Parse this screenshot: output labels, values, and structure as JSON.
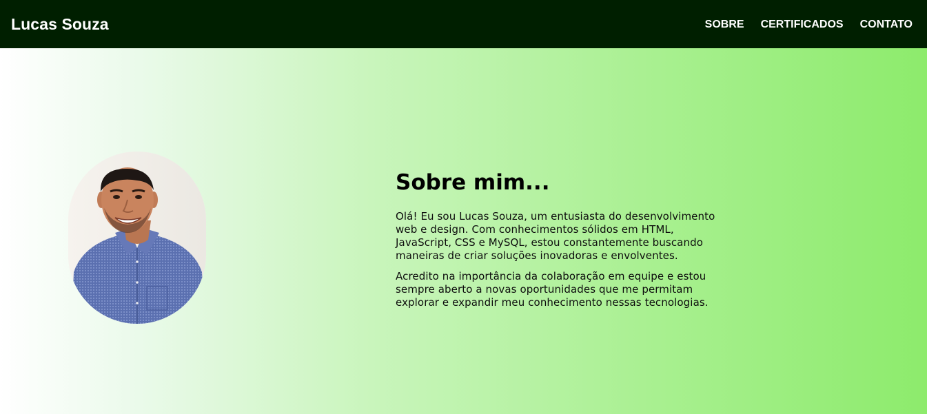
{
  "header": {
    "brand": "Lucas Souza",
    "nav": [
      {
        "label": "SOBRE"
      },
      {
        "label": "CERTIFICADOS"
      },
      {
        "label": "CONTATO"
      }
    ]
  },
  "about": {
    "title": "Sobre mim...",
    "paragraphs": [
      "Olá! Eu sou Lucas Souza, um entusiasta do desenvolvimento web e design. Com conhecimentos sólidos em HTML, JavaScript, CSS e MySQL, estou constantemente buscando maneiras de criar soluções inovadoras e envolventes.",
      "Acredito na importância da colaboração em equipe e estou sempre aberto a novas oportunidades que me permitam explorar e expandir meu conhecimento nessas tecnologias."
    ]
  },
  "colors": {
    "navbar": "#001f00",
    "gradient_start": "#ffffff",
    "gradient_end": "#8deb6c",
    "shirt": "#5a6fae"
  }
}
